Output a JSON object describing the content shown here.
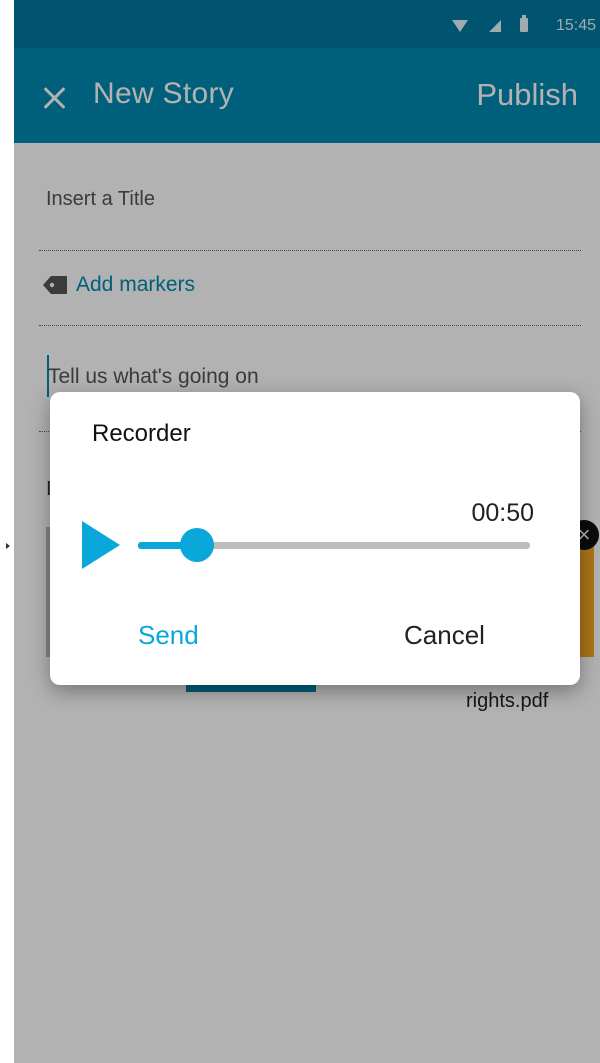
{
  "status_bar": {
    "time": "15:45"
  },
  "toolbar": {
    "title": "New Story",
    "publish_label": "Publish"
  },
  "form": {
    "title_placeholder": "Insert a Title",
    "markers_label": "Add markers",
    "story_placeholder": "Tell us what's going on"
  },
  "attachments": {
    "pdf_name": "rights.pdf"
  },
  "recorder": {
    "title": "Recorder",
    "time": "00:50",
    "progress": 0.15,
    "send_label": "Send",
    "cancel_label": "Cancel"
  },
  "colors": {
    "primary": "#0088b1",
    "accent": "#0aa7db",
    "status_bar": "#0079a0"
  }
}
